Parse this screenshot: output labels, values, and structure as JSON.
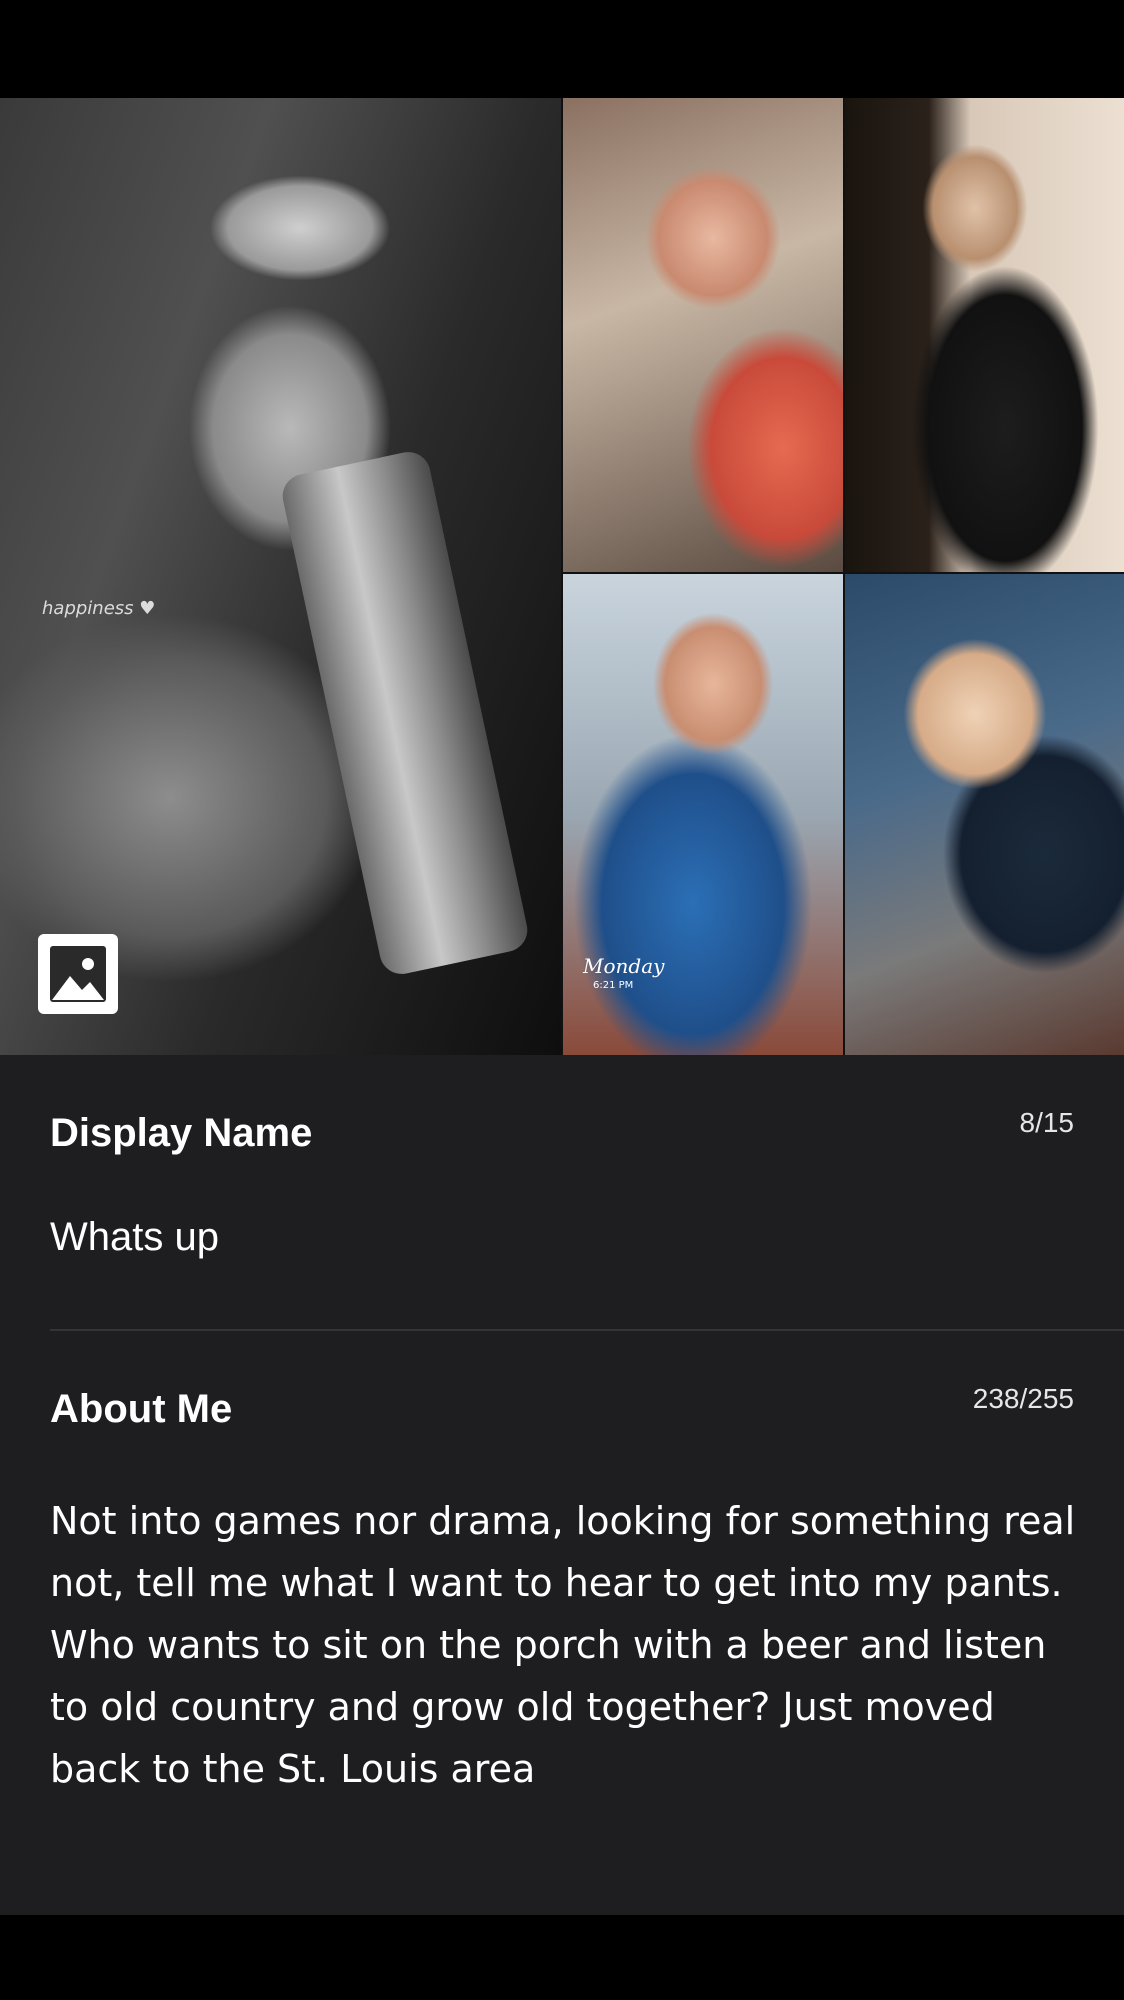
{
  "photos": {
    "main_caption": "happiness ♥",
    "story_title": "Monday",
    "story_time": "6:21 PM"
  },
  "display_name": {
    "label": "Display Name",
    "counter": "8/15",
    "value": "Whats up"
  },
  "about_me": {
    "label": "About Me",
    "counter": "238/255",
    "value": "Not into games nor drama, looking for something real not, tell me what I want to hear to get into my pants. Who wants to sit on the porch with a beer and listen to old country and grow old together?  Just moved back to the St. Louis area"
  },
  "colors": {
    "panel_background": "#1e1e20",
    "text": "#ffffff",
    "divider": "#333338"
  }
}
